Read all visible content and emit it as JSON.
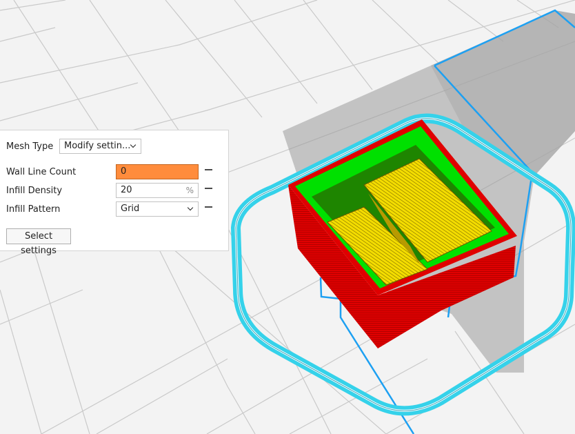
{
  "colors": {
    "grid_background": "#f3f3f3",
    "grid_line": "#c8c8c8",
    "wall_red": "#e00000",
    "top_green": "#00e000",
    "infill_yellow": "#f0d800",
    "skirt_cyan": "#35d2ea",
    "travel_blue": "#1da0f2",
    "modifier_grey": "#9a9a9a",
    "highlight_orange": "#ff8c3c"
  },
  "panel": {
    "mesh_type_label": "Mesh Type",
    "mesh_type_value": "Modify settin...",
    "settings": [
      {
        "label": "Wall Line Count",
        "value": "0",
        "unit": "",
        "icon": "minus-icon"
      },
      {
        "label": "Infill Density",
        "value": "20",
        "unit": "%",
        "icon": "minus-icon"
      },
      {
        "label": "Infill Pattern",
        "value": "Grid",
        "unit": "",
        "icon": "minus-icon"
      }
    ],
    "select_settings_label": "Select settings"
  }
}
